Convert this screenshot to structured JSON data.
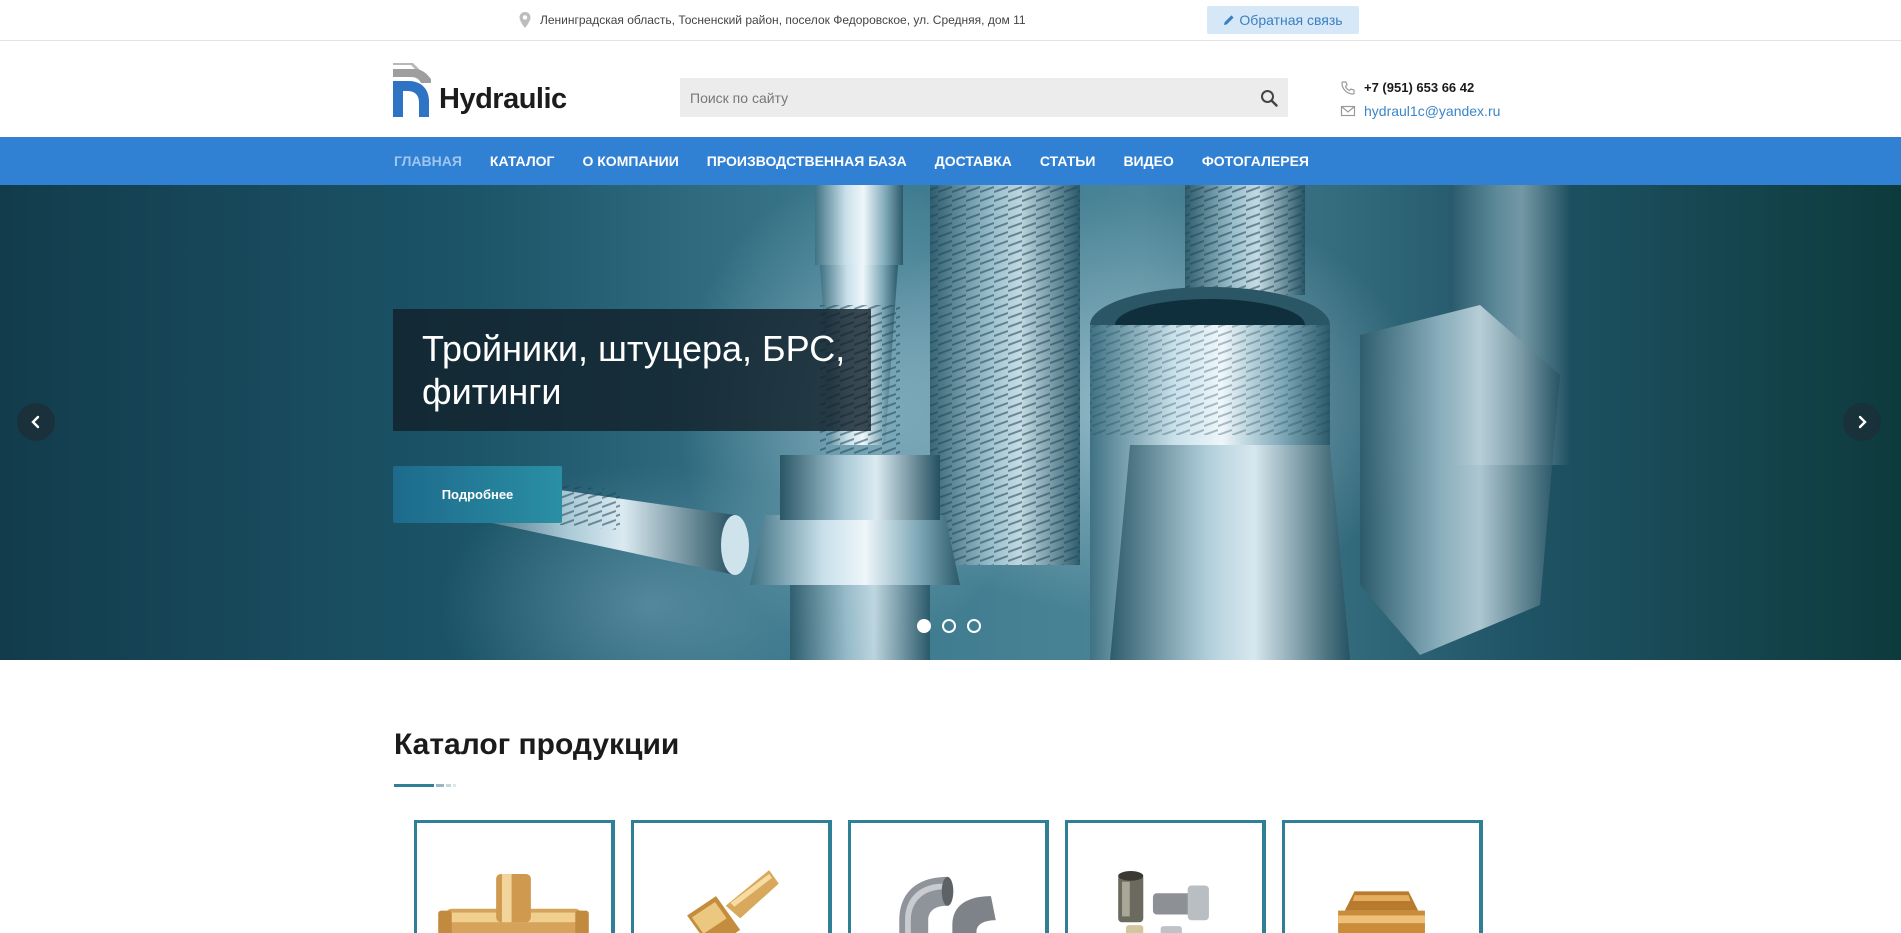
{
  "topbar": {
    "address": "Ленинградская область, Тосненский район, поселок Федоровское, ул. Средняя, дом 11",
    "address_icon": "map-pin-icon",
    "feedback_label": "Обратная связь",
    "feedback_icon": "pencil-icon"
  },
  "header": {
    "logo_text": "Hydraulic",
    "search_placeholder": "Поиск по сайту",
    "search_icon": "search-icon",
    "phone": "+7 (951) 653 66 42",
    "phone_icon": "phone-icon",
    "email": "hydraul1c@yandex.ru",
    "email_icon": "envelope-icon"
  },
  "nav": {
    "items": [
      {
        "label": "ГЛАВНАЯ",
        "active": true
      },
      {
        "label": "КАТАЛОГ"
      },
      {
        "label": "О КОМПАНИИ"
      },
      {
        "label": "ПРОИЗВОДСТВЕННАЯ БАЗА"
      },
      {
        "label": "ДОСТАВКА"
      },
      {
        "label": "СТАТЬИ"
      },
      {
        "label": "ВИДЕО"
      },
      {
        "label": "ФОТОГАЛЕРЕЯ"
      }
    ]
  },
  "hero": {
    "title_line1": "Тройники, штуцера, БРС,",
    "title_line2": "фитинги",
    "button_label": "Подробнее",
    "slide_count": 3,
    "active_slide": 1
  },
  "catalog": {
    "title": "Каталог продукции",
    "cards": [
      {
        "image": "brass-tee-fitting"
      },
      {
        "image": "brass-hose-barb-fitting"
      },
      {
        "image": "steel-elbow-fittings"
      },
      {
        "image": "quick-release-couplings"
      },
      {
        "image": "brass-nipple-adapter"
      }
    ]
  },
  "colors": {
    "accent": "#3080d4",
    "nav_active": "#9fc6ef",
    "link": "#3a86c8",
    "card_border": "#2f7f97"
  }
}
